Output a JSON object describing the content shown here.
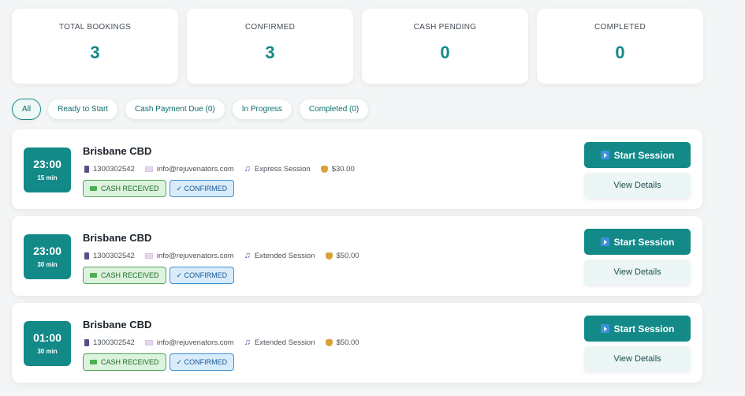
{
  "stats": [
    {
      "label": "TOTAL BOOKINGS",
      "value": "3"
    },
    {
      "label": "CONFIRMED",
      "value": "3"
    },
    {
      "label": "CASH PENDING",
      "value": "0"
    },
    {
      "label": "COMPLETED",
      "value": "0"
    }
  ],
  "filters": [
    {
      "label": "All",
      "active": true
    },
    {
      "label": "Ready to Start",
      "active": false
    },
    {
      "label": "Cash Payment Due (0)",
      "active": false
    },
    {
      "label": "In Progress",
      "active": false
    },
    {
      "label": "Completed (0)",
      "active": false
    }
  ],
  "bookings": [
    {
      "time": "23:00",
      "duration": "15 min",
      "location": "Brisbane CBD",
      "phone": "1300302542",
      "email": "info@rejuvenators.com",
      "session": "Express Session",
      "price": "$30.00",
      "badge_cash": "CASH RECEIVED",
      "badge_status": "✓ CONFIRMED",
      "start_label": "Start Session",
      "view_label": "View Details"
    },
    {
      "time": "23:00",
      "duration": "30 min",
      "location": "Brisbane CBD",
      "phone": "1300302542",
      "email": "info@rejuvenators.com",
      "session": "Extended Session",
      "price": "$50.00",
      "badge_cash": "CASH RECEIVED",
      "badge_status": "✓ CONFIRMED",
      "start_label": "Start Session",
      "view_label": "View Details"
    },
    {
      "time": "01:00",
      "duration": "30 min",
      "location": "Brisbane CBD",
      "phone": "1300302542",
      "email": "info@rejuvenators.com",
      "session": "Extended Session",
      "price": "$50.00",
      "badge_cash": "CASH RECEIVED",
      "badge_status": "✓ CONFIRMED",
      "start_label": "Start Session",
      "view_label": "View Details"
    }
  ],
  "colors": {
    "accent": "#138a88",
    "cash_badge": "#dcf3dd",
    "confirmed_badge": "#d9ecfb"
  },
  "icons": [
    "phone-icon",
    "mail-icon",
    "music-note-icon",
    "money-bag-icon",
    "cash-icon",
    "play-icon"
  ]
}
